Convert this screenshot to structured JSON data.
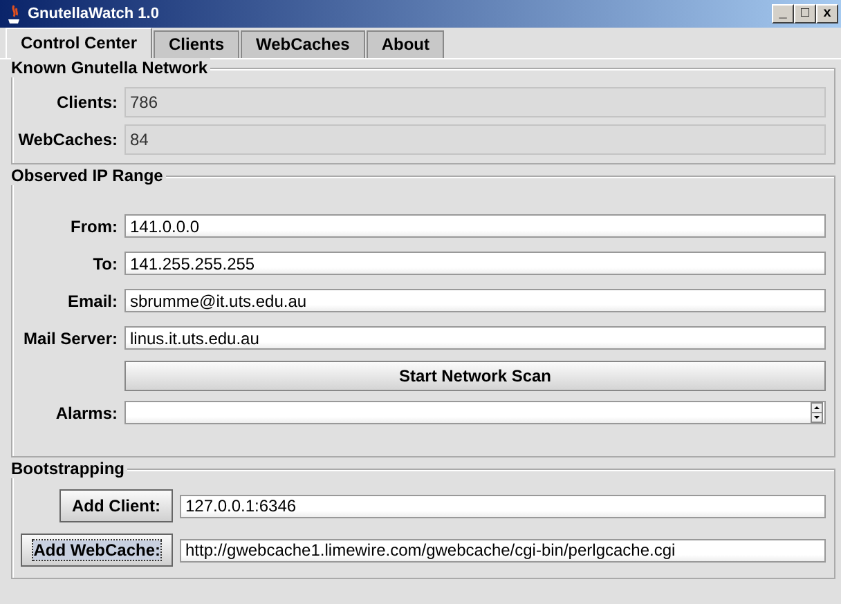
{
  "window": {
    "title": "GnutellaWatch 1.0",
    "controls": [
      "_",
      "□",
      "x"
    ]
  },
  "tabs": [
    {
      "label": "Control Center",
      "selected": true
    },
    {
      "label": "Clients",
      "selected": false
    },
    {
      "label": "WebCaches",
      "selected": false
    },
    {
      "label": "About",
      "selected": false
    }
  ],
  "known_network": {
    "title": "Known Gnutella Network",
    "rows": [
      {
        "kind": "readonly",
        "label": "Clients:",
        "value": "786"
      },
      {
        "kind": "readonly",
        "label": "WebCaches:",
        "value": "84"
      }
    ]
  },
  "observed_ip_range": {
    "title": "Observed IP Range",
    "rows": [
      {
        "kind": "input",
        "label": "From:",
        "value": "141.0.0.0"
      },
      {
        "kind": "input",
        "label": "To:",
        "value": "141.255.255.255"
      },
      {
        "kind": "input",
        "label": "Email:",
        "value": "sbrumme@it.uts.edu.au"
      },
      {
        "kind": "input",
        "label": "Mail Server:",
        "value": "linus.it.uts.edu.au"
      },
      {
        "kind": "button",
        "label": "Start Network Scan"
      },
      {
        "kind": "spinner",
        "label": "Alarms:"
      }
    ]
  },
  "bootstrapping": {
    "title": "Bootstrapping",
    "rows": [
      {
        "button": "Add Client:",
        "focused": false,
        "value": "127.0.0.1:6346"
      },
      {
        "button": "Add WebCache:",
        "focused": true,
        "value": "http://gwebcache1.limewire.com/gwebcache/cgi-bin/perlgcache.cgi"
      }
    ]
  }
}
